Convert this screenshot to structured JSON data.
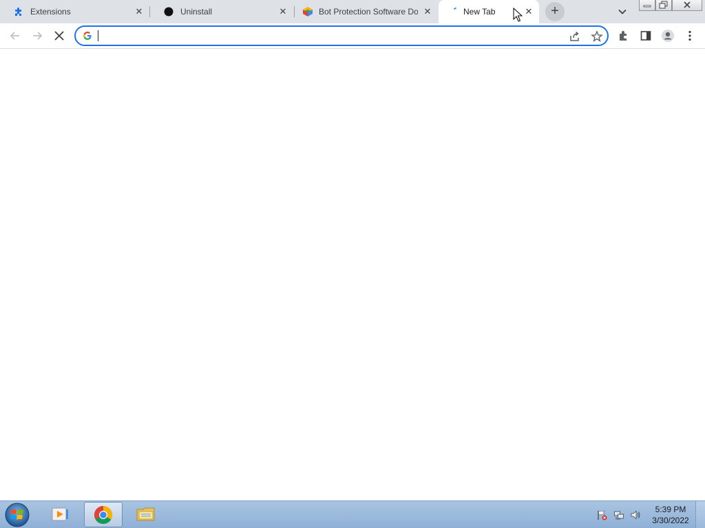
{
  "browser": {
    "tabs": [
      {
        "title": "Extensions",
        "icon": "puzzle-icon",
        "active": false
      },
      {
        "title": "Uninstall",
        "icon": "black-circle-icon",
        "active": false
      },
      {
        "title": "Bot Protection Software Do",
        "icon": "colorful-logo-icon",
        "active": false
      },
      {
        "title": "New Tab",
        "icon": "loading-spinner-icon",
        "active": true
      }
    ],
    "new_tab_symbol": "+",
    "close_symbol": "✕",
    "omnibox": {
      "value": "",
      "placeholder": ""
    },
    "colors": {
      "accent": "#1a73e8",
      "tabstrip": "#dee1e6"
    }
  },
  "taskbar": {
    "apps": [
      "chrome",
      "media-player",
      "file-explorer"
    ],
    "clock_time": "5:39 PM",
    "clock_date": "3/30/2022",
    "colors": {
      "bar": "#a9c4e2"
    }
  }
}
